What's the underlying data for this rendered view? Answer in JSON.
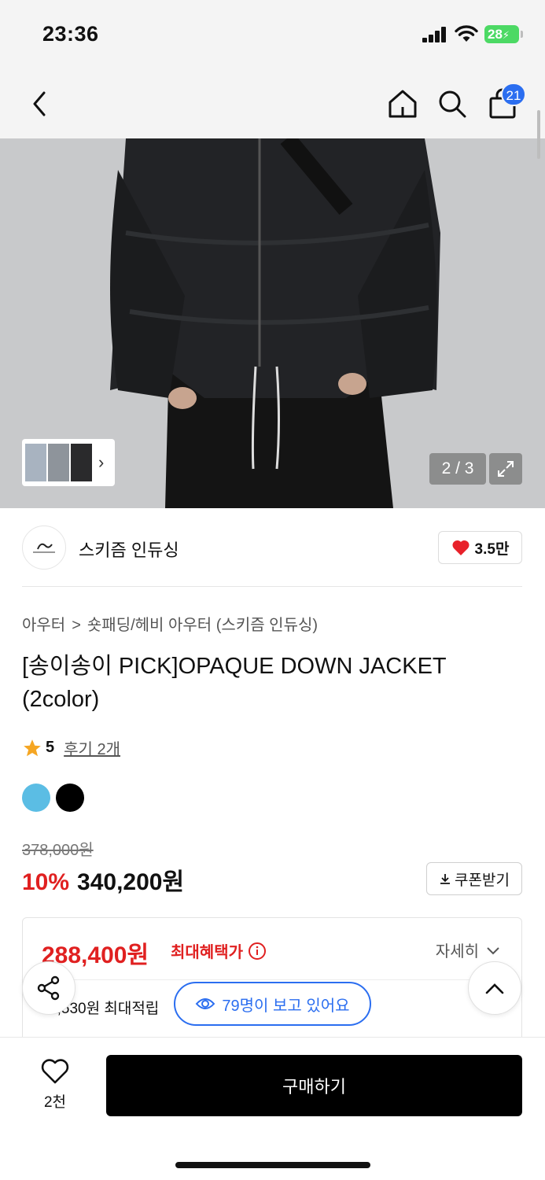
{
  "status": {
    "time": "23:36",
    "battery": "28"
  },
  "nav": {
    "cart_count": "21"
  },
  "gallery": {
    "page": "2 / 3"
  },
  "brand": {
    "name": "스키즘 인듀싱",
    "likes": "3.5만"
  },
  "breadcrumb": {
    "category": "아우터",
    "separator": ">",
    "subcategory": "숏패딩/헤비 아우터 (스키즘 인듀싱)"
  },
  "product": {
    "title": "[송이송이 PICK]OPAQUE DOWN JACKET (2color)",
    "rating": "5",
    "reviews": "후기 2개",
    "colors": [
      "#5bbde4",
      "#000000"
    ],
    "original_price": "378,000원",
    "discount": "10%",
    "sale_price": "340,200원"
  },
  "coupon": {
    "label": "쿠폰받기"
  },
  "benefit": {
    "price": "288,400원",
    "label": "최대혜택가",
    "detail": "자세히",
    "points": "',530원 최대적립"
  },
  "viewers": {
    "label": "79명이 보고 있어요"
  },
  "bottom": {
    "wish_count": "2천",
    "buy_label": "구매하기"
  }
}
